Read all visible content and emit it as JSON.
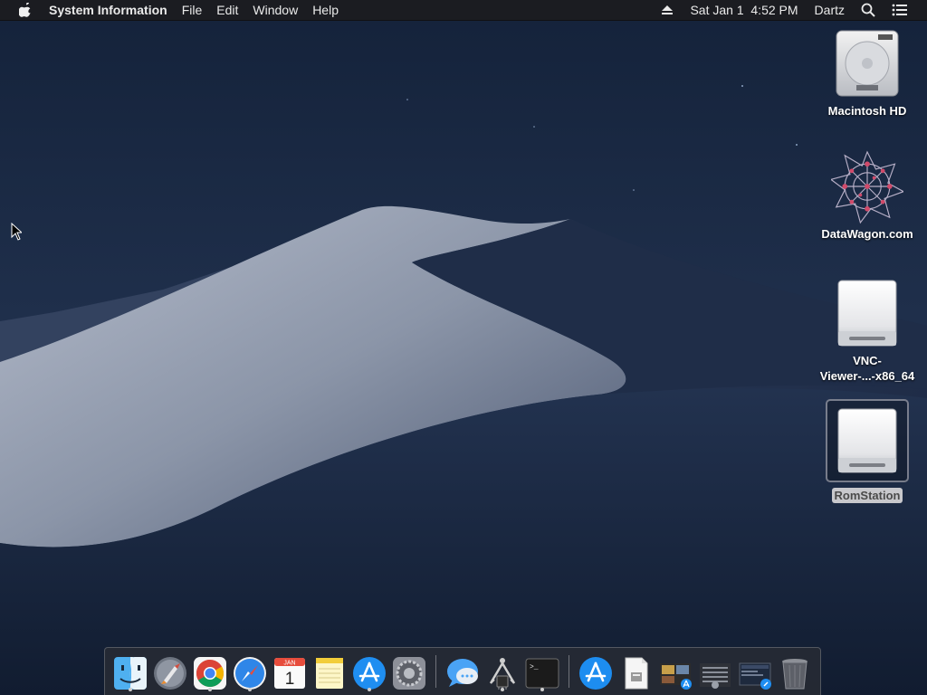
{
  "menubar": {
    "apple_icon": "apple-icon",
    "app_name": "System Information",
    "menus": [
      "File",
      "Edit",
      "Window",
      "Help"
    ],
    "status": {
      "eject_icon": "eject-icon",
      "datetime": "Sat Jan 1  4:52 PM",
      "user": "Dartz",
      "search_icon": "spotlight-search-icon",
      "list_icon": "notification-center-icon"
    }
  },
  "desktop": {
    "icons": [
      {
        "label": "Macintosh HD",
        "icon": "hard-drive-icon"
      },
      {
        "label": "DataWagon.com",
        "icon": "datawagon-icon"
      },
      {
        "label": "VNC-\nViewer-...-x86_64",
        "icon": "disk-image-icon"
      },
      {
        "label": "RomStation",
        "icon": "disk-image-icon",
        "selected": true
      }
    ]
  },
  "dock": {
    "apps": [
      {
        "name": "Finder",
        "icon": "finder-icon",
        "running": true
      },
      {
        "name": "Launchpad",
        "icon": "launchpad-icon",
        "running": false
      },
      {
        "name": "Google Chrome",
        "icon": "chrome-icon",
        "running": true
      },
      {
        "name": "Safari",
        "icon": "safari-icon",
        "running": true
      },
      {
        "name": "Calendar",
        "icon": "calendar-icon",
        "running": false,
        "month": "JAN",
        "day": "1"
      },
      {
        "name": "Notes",
        "icon": "notes-icon",
        "running": false
      },
      {
        "name": "App Store",
        "icon": "app-store-icon",
        "running": true
      },
      {
        "name": "System Preferences",
        "icon": "system-preferences-icon",
        "running": false
      },
      {
        "name": "Messages",
        "icon": "messages-icon",
        "running": false
      },
      {
        "name": "System Information",
        "icon": "system-information-icon",
        "running": true
      },
      {
        "name": "Terminal",
        "icon": "terminal-icon",
        "running": true
      },
      {
        "name": "Applications",
        "icon": "app-store-folder-icon",
        "running": false
      },
      {
        "name": "Document",
        "icon": "document-icon",
        "running": false
      },
      {
        "name": "Downloads",
        "icon": "downloads-stack-icon",
        "running": false
      },
      {
        "name": "Recent Items",
        "icon": "recent-items-stack-icon",
        "running": false
      },
      {
        "name": "Screenshots",
        "icon": "screenshots-stack-icon",
        "running": false
      },
      {
        "name": "Trash",
        "icon": "trash-icon",
        "running": false
      }
    ]
  },
  "colors": {
    "menubar_bg": "#1c1c20",
    "sky_top": "#15233a",
    "dune_light": "#9ea7b8",
    "dune_dark": "#1d2b45"
  }
}
